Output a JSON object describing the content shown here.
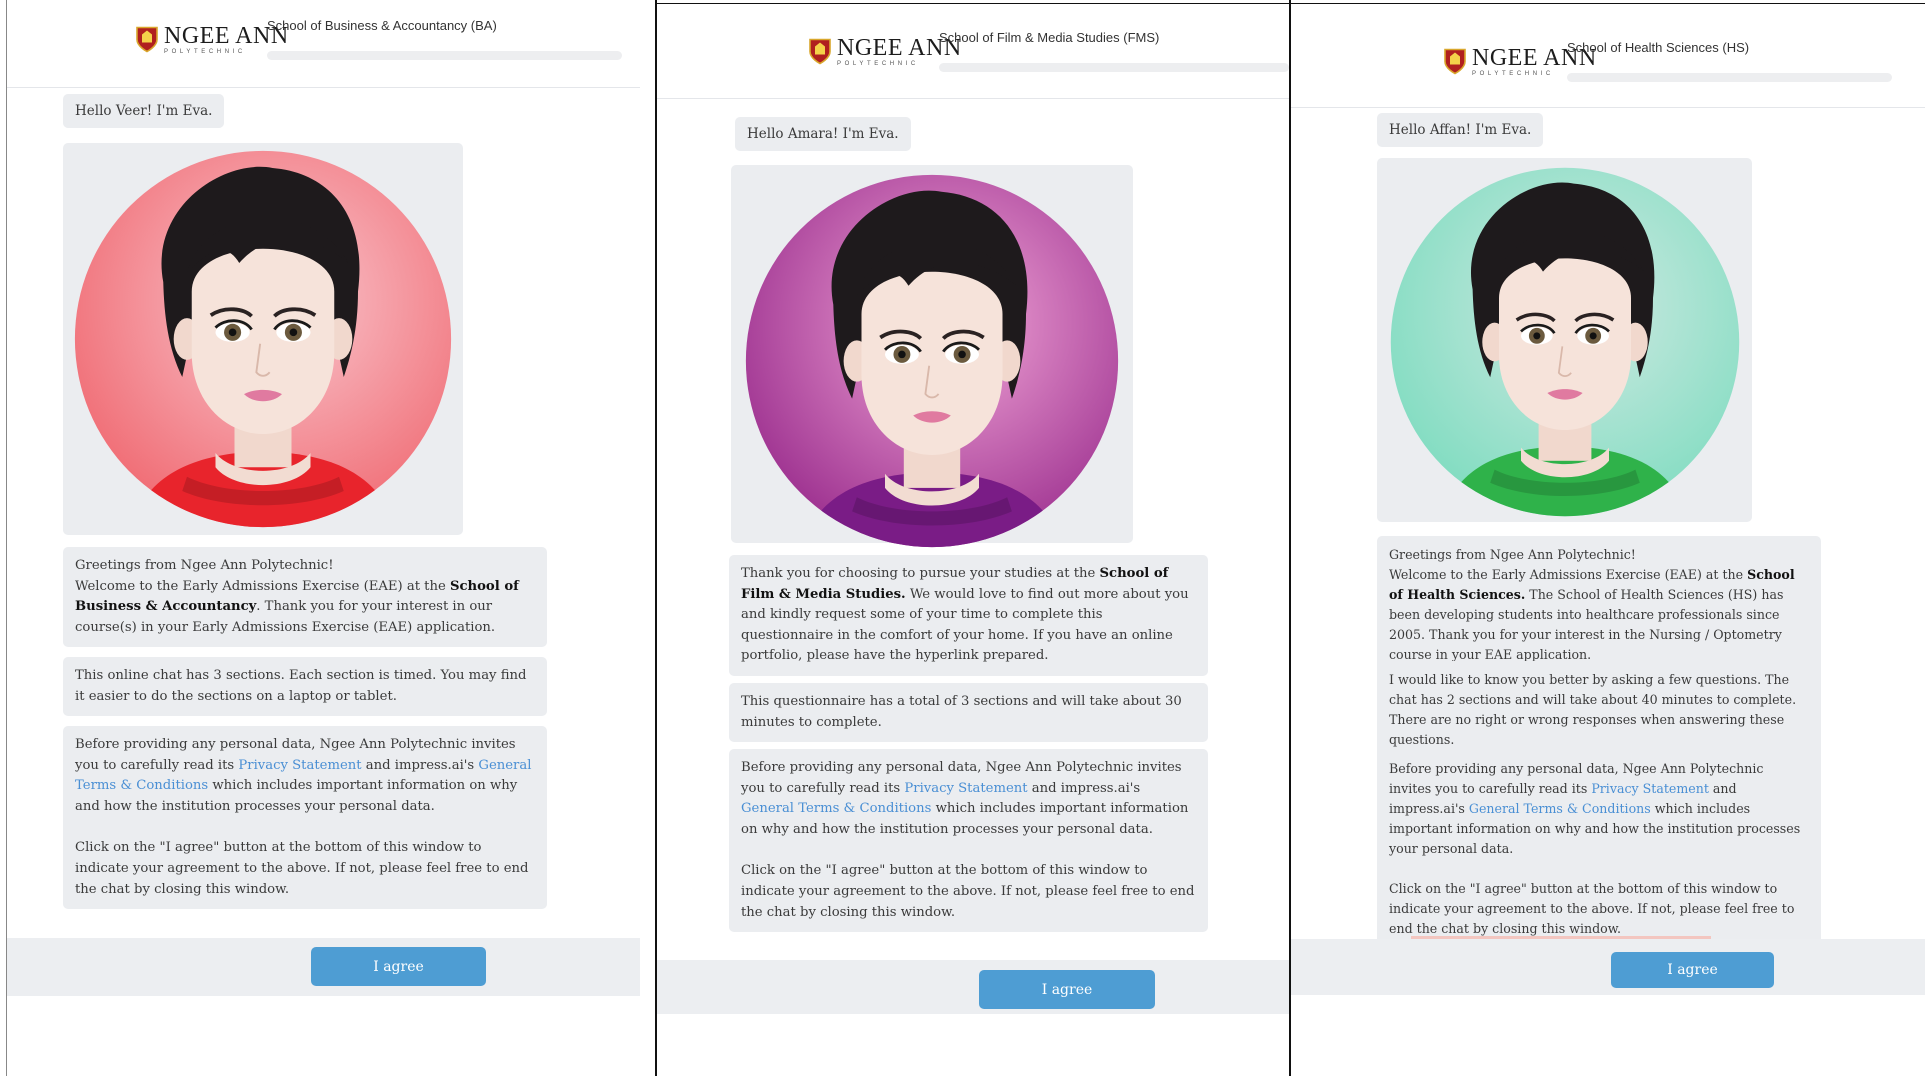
{
  "logo": {
    "name": "NGEE ANN",
    "subtitle": "POLYTECHNIC"
  },
  "agree_label": "I agree",
  "panels": [
    {
      "school": "School of Business & Accountancy (BA)",
      "hello": "Hello Veer! I'm Eva.",
      "avatar_colors": {
        "outer": "#f06a72",
        "inner": "#f9c7cf",
        "shirt": "#e8242c"
      },
      "welcome": {
        "line1": "Greetings from Ngee Ann Polytechnic!",
        "pre": "Welcome to the Early Admissions Exercise (EAE) at the ",
        "bold": "School of Business & Accountancy",
        "post": ". Thank you for your interest in our course(s) in your Early Admissions Exercise (EAE) application."
      },
      "sections_text": "This online chat has 3 sections. Each section is timed. You may find it easier to do the sections on a laptop or tablet.",
      "privacy": {
        "pre": "Before providing any personal data, Ngee Ann Polytechnic invites you to carefully read its ",
        "link1": "Privacy Statement",
        "mid": " and impress.ai's ",
        "link2": "General Terms & Conditions",
        "post": " which includes important information on why and how the institution processes your personal data.",
        "agree_text": "Click on the \"I agree\" button at the bottom of this window to indicate your agreement to the above. If not, please feel free to end the chat by closing this window."
      }
    },
    {
      "school": "School of Film & Media Studies (FMS)",
      "hello": "Hello Amara! I'm Eva.",
      "avatar_colors": {
        "outer": "#9b2e8e",
        "inner": "#f3a8d8",
        "shirt": "#7a1c86"
      },
      "welcome": {
        "line1": "",
        "pre": "Thank you for choosing to pursue your studies at the ",
        "bold": "School of Film & Media Studies.",
        "post": " We would love to find out more about you and kindly request some of your time to complete this questionnaire in the comfort of your home. If you have an online portfolio, please have the hyperlink prepared."
      },
      "sections_text": "This questionnaire has a total of 3 sections and will take about 30 minutes to complete.",
      "privacy": {
        "pre": "Before providing any personal data, Ngee Ann Polytechnic invites you to carefully read its ",
        "link1": "Privacy Statement",
        "mid": " and impress.ai's ",
        "link2": "General Terms & Conditions",
        "post": " which includes important information on why and how the institution processes your personal data.",
        "agree_text": "Click on the \"I agree\" button at the bottom of this window to indicate your agreement to the above. If not, please feel free to end the chat by closing this window."
      }
    },
    {
      "school": "School of Health Sciences (HS)",
      "hello": "Hello Affan! I'm Eva.",
      "avatar_colors": {
        "outer": "#7fdcc0",
        "inner": "#cfe9e2",
        "shirt": "#2fb24a"
      },
      "welcome": {
        "line1": "Greetings from Ngee Ann Polytechnic!",
        "pre": "Welcome to the Early Admissions Exercise (EAE) at the ",
        "bold": "School of Health Sciences.",
        "post": " The School of Health Sciences (HS) has been developing students into healthcare professionals since 2005. Thank you for your interest in the Nursing / Optometry course in your EAE application."
      },
      "sections_text": "I would like to know you better by asking a few questions. The chat has 2 sections and will take about 40 minutes to complete. There are no right or wrong responses when answering these questions.",
      "privacy": {
        "pre": "Before providing any personal data, Ngee Ann Polytechnic invites you to carefully read its ",
        "link1": "Privacy Statement",
        "mid": " and impress.ai's ",
        "link2": "General Terms & Conditions",
        "post": " which includes important information on why and how the institution processes your personal data.",
        "agree_text": "Click on the \"I agree\" button at the bottom of this window to indicate your agreement to the above. If not, please feel free to end the chat by closing this window."
      }
    }
  ]
}
